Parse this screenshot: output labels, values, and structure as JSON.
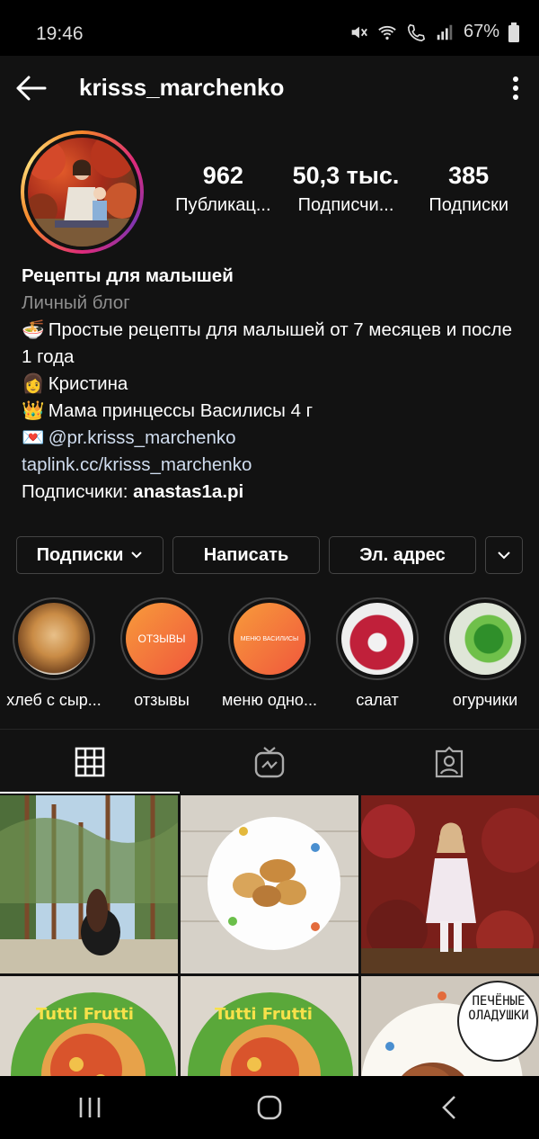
{
  "status_bar": {
    "time": "19:46",
    "battery": "67%"
  },
  "header": {
    "username": "krisss_marchenko"
  },
  "stats": [
    {
      "count": "962",
      "label": "Публикац..."
    },
    {
      "count": "50,3 тыс.",
      "label": "Подписчи..."
    },
    {
      "count": "385",
      "label": "Подписки"
    }
  ],
  "bio": {
    "name": "Рецепты  для малышей",
    "category": "Личный блог",
    "line1": "Простые рецепты для малышей от 7 месяцев и после 1 года",
    "line2": "Кристина",
    "line3": "Мама принцессы Василисы 4 г",
    "line4": "@pr.krisss_marchenko",
    "link": "taplink.cc/krisss_marchenko",
    "followers_prefix": "Подписчики: ",
    "followers_user": "anastas1a.pi",
    "emoji1": "🍜",
    "emoji2": "👩",
    "emoji3": "👑",
    "emoji4": "💌"
  },
  "buttons": {
    "following": "Подписки",
    "message": "Написать",
    "email": "Эл. адрес"
  },
  "highlights": [
    {
      "title": "хлеб с сыр...",
      "cover_text": ""
    },
    {
      "title": "отзывы",
      "cover_text": "ОТЗЫВЫ"
    },
    {
      "title": "меню одно...",
      "cover_text": "МЕНЮ ВАСИЛИСЫ"
    },
    {
      "title": "салат",
      "cover_text": ""
    },
    {
      "title": "огурчики",
      "cover_text": ""
    }
  ],
  "grid": {
    "tile6_label": "ПЕЧЁНЫЕ ОЛАДУШКИ",
    "tile4_text": "Tutti Frutti",
    "tile5_text": "Tutti Frutti"
  },
  "colors": {
    "background": "#121212",
    "story_gradient": [
      "#f58529",
      "#dd2a7b",
      "#8134af"
    ],
    "highlight_orange": "#f2643a"
  }
}
